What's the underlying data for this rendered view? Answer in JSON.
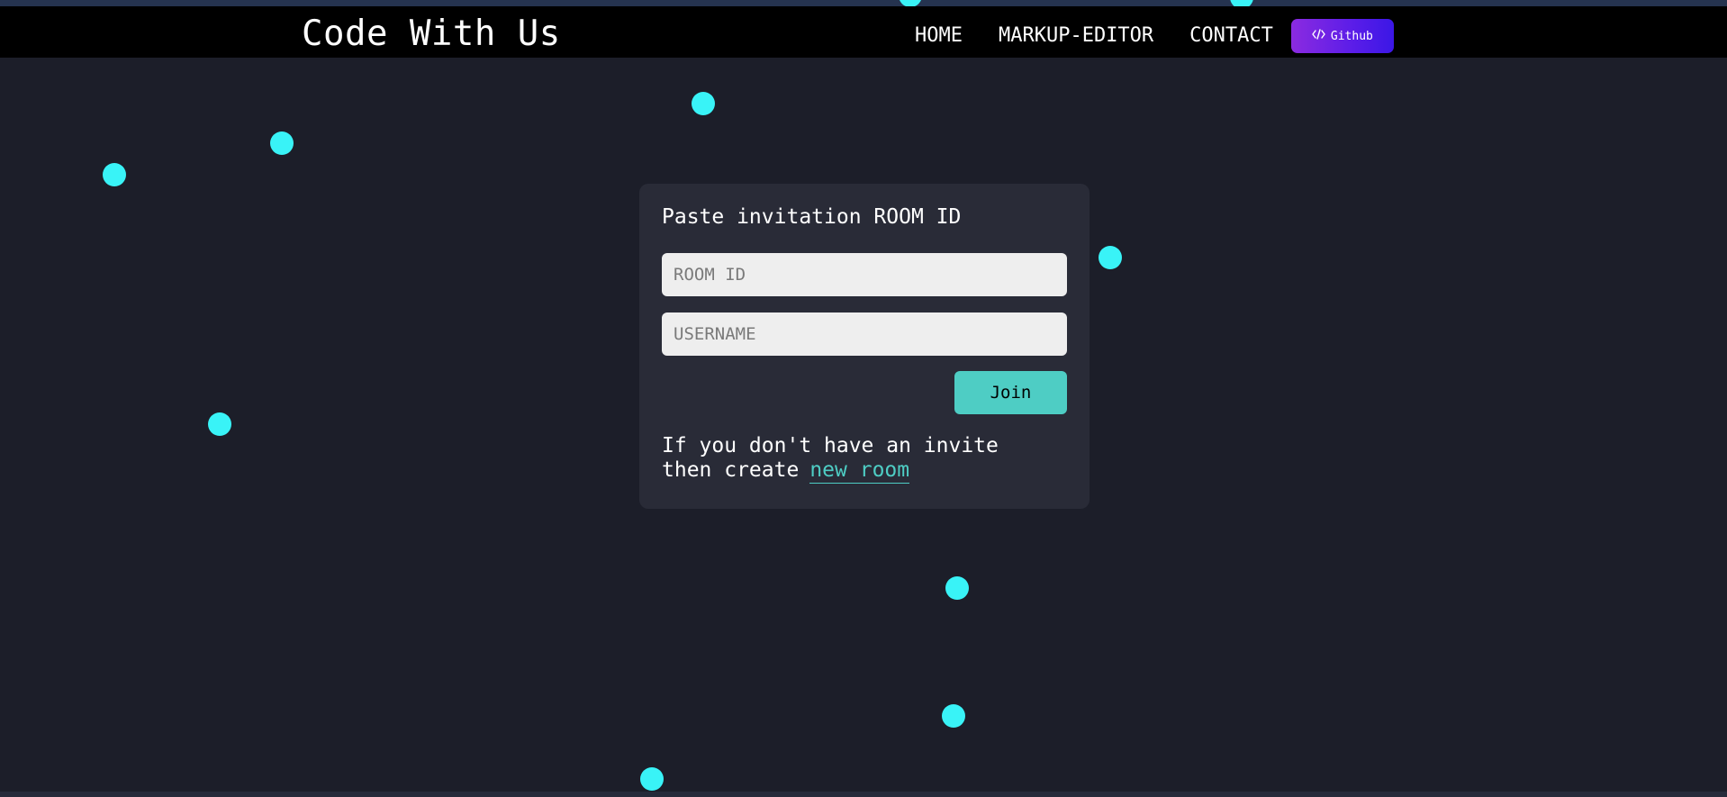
{
  "colors": {
    "background": "#1c1e29",
    "navbar": "#000000",
    "card": "#292b37",
    "accent": "#4ecdc4",
    "dot": "#39f3f7",
    "github_gradient_start": "#8b2be0",
    "github_gradient_end": "#3b17e6"
  },
  "navbar": {
    "brand": "Code With Us",
    "links": [
      {
        "label": "HOME"
      },
      {
        "label": "MARKUP-EDITOR"
      },
      {
        "label": "CONTACT"
      }
    ],
    "github_label": "Github",
    "github_icon": "code-icon"
  },
  "join_card": {
    "title": "Paste invitation ROOM ID",
    "room_id_placeholder": "ROOM ID",
    "room_id_value": "",
    "username_placeholder": "USERNAME",
    "username_value": "",
    "join_label": "Join",
    "info_text": "If you don't have an invite then create",
    "new_room_link": "new room"
  }
}
